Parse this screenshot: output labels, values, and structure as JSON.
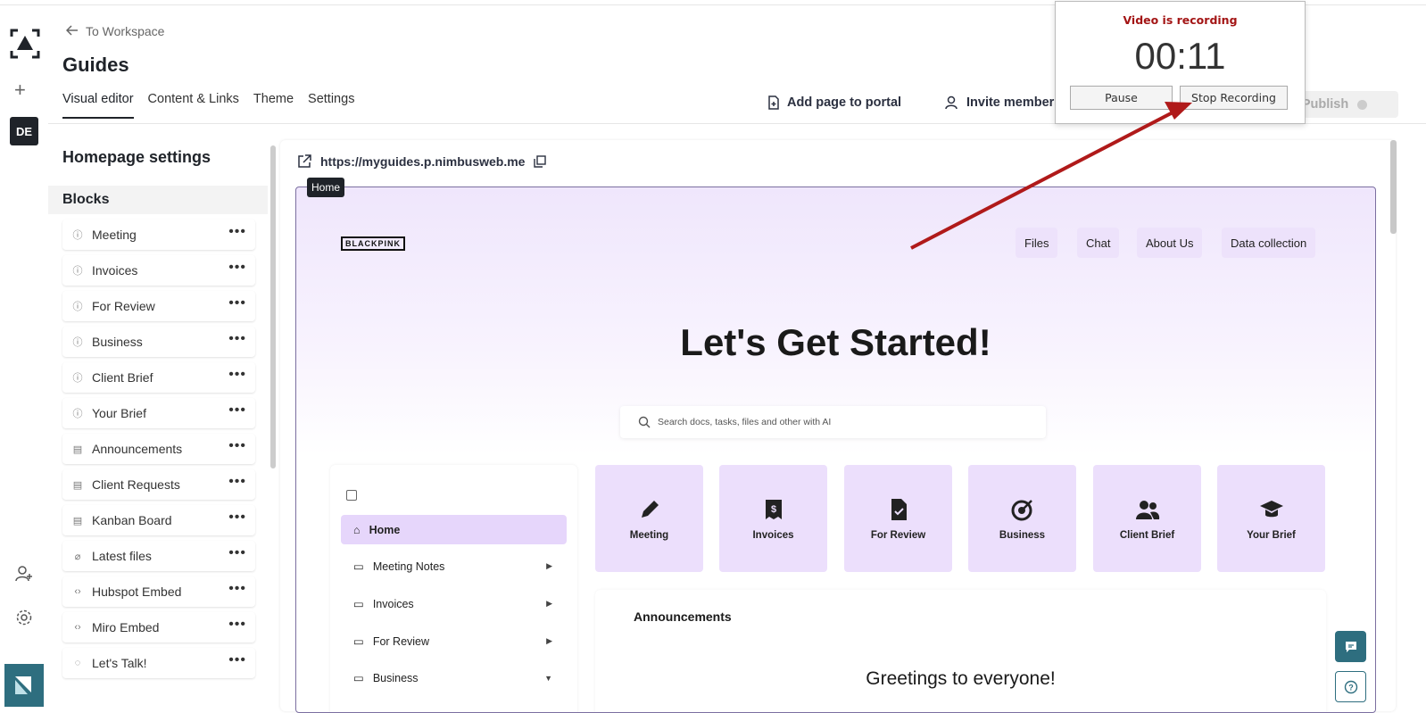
{
  "header": {
    "back_label": "To Workspace",
    "title": "Guides",
    "tabs": [
      {
        "label": "Visual editor",
        "active": true
      },
      {
        "label": "Content & Links",
        "active": false
      },
      {
        "label": "Theme",
        "active": false
      },
      {
        "label": "Settings",
        "active": false
      }
    ],
    "add_page_label": "Add page to portal",
    "invite_label": "Invite members",
    "publish_label": "Publish"
  },
  "rail": {
    "avatar_initials": "DE"
  },
  "recording": {
    "status": "Video is recording",
    "time": "00:11",
    "pause_label": "Pause",
    "stop_label": "Stop Recording",
    "status_color": "#a31515"
  },
  "panel": {
    "title": "Homepage settings",
    "blocks_label": "Blocks",
    "blocks": [
      {
        "label": "Meeting",
        "icon": "info-icon"
      },
      {
        "label": "Invoices",
        "icon": "info-icon"
      },
      {
        "label": "For Review",
        "icon": "info-icon"
      },
      {
        "label": "Business",
        "icon": "info-icon"
      },
      {
        "label": "Client Brief",
        "icon": "info-icon"
      },
      {
        "label": "Your Brief",
        "icon": "info-icon"
      },
      {
        "label": "Announcements",
        "icon": "document-icon"
      },
      {
        "label": "Client Requests",
        "icon": "document-icon"
      },
      {
        "label": "Kanban Board",
        "icon": "document-icon"
      },
      {
        "label": "Latest files",
        "icon": "paperclip-icon"
      },
      {
        "label": "Hubspot Embed",
        "icon": "code-icon"
      },
      {
        "label": "Miro Embed",
        "icon": "code-icon"
      },
      {
        "label": "Let's Talk!",
        "icon": "chat-icon"
      }
    ]
  },
  "preview": {
    "url": "https://myguides.p.nimbusweb.me",
    "home_tooltip": "Home",
    "logo_text": "BLACKPINK",
    "nav": [
      "Files",
      "Chat",
      "About Us",
      "Data collection"
    ],
    "hero": "Let's Get Started!",
    "search_placeholder": "Search docs, tasks, files and other with AI",
    "sidenav": [
      {
        "label": "Home",
        "active": true
      },
      {
        "label": "Meeting Notes",
        "arrow": "right"
      },
      {
        "label": "Invoices",
        "arrow": "right"
      },
      {
        "label": "For Review",
        "arrow": "right"
      },
      {
        "label": "Business",
        "arrow": "down"
      }
    ],
    "tiles": [
      "Meeting",
      "Invoices",
      "For Review",
      "Business",
      "Client Brief",
      "Your Brief"
    ],
    "announcements_title": "Announcements",
    "greeting": "Greetings to everyone!"
  },
  "colors": {
    "accent": "#2e6e7f",
    "tile_bg": "#ecdffc",
    "arrow": "#b01a1a"
  }
}
